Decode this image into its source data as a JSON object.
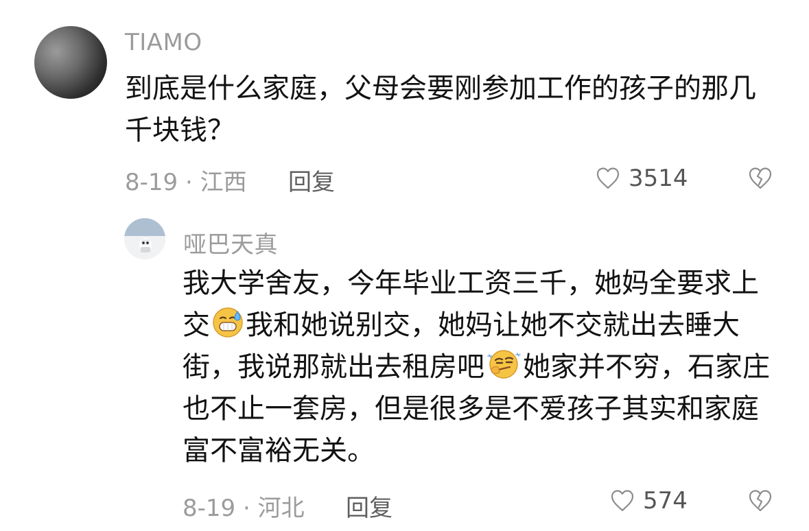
{
  "comments": [
    {
      "username": "TIAMO",
      "text": "到底是什么家庭，父母会要刚参加工作的孩子的那几千块钱？",
      "meta": "8-19 · 江西",
      "reply_label": "回复",
      "likes": "3514",
      "avatar_icon": "avatar-car-photo"
    },
    {
      "username": "哑巴天真",
      "text_parts": [
        "我大学舍友，今年毕业工资三千，她妈全要求上交",
        "我和她说别交，她妈让她不交就出去睡大街，我说那就出去租房吧",
        "她家并不穷，石家庄也不止一套房，但是很多是不爱孩子其实和家庭富不富裕无关。"
      ],
      "emoji_1": "nervous-grin-emoji",
      "emoji_2": "smirk-thinking-emoji",
      "meta": "8-19 · 河北",
      "reply_label": "回复",
      "likes": "574",
      "avatar_icon": "avatar-figurine-photo"
    }
  ]
}
